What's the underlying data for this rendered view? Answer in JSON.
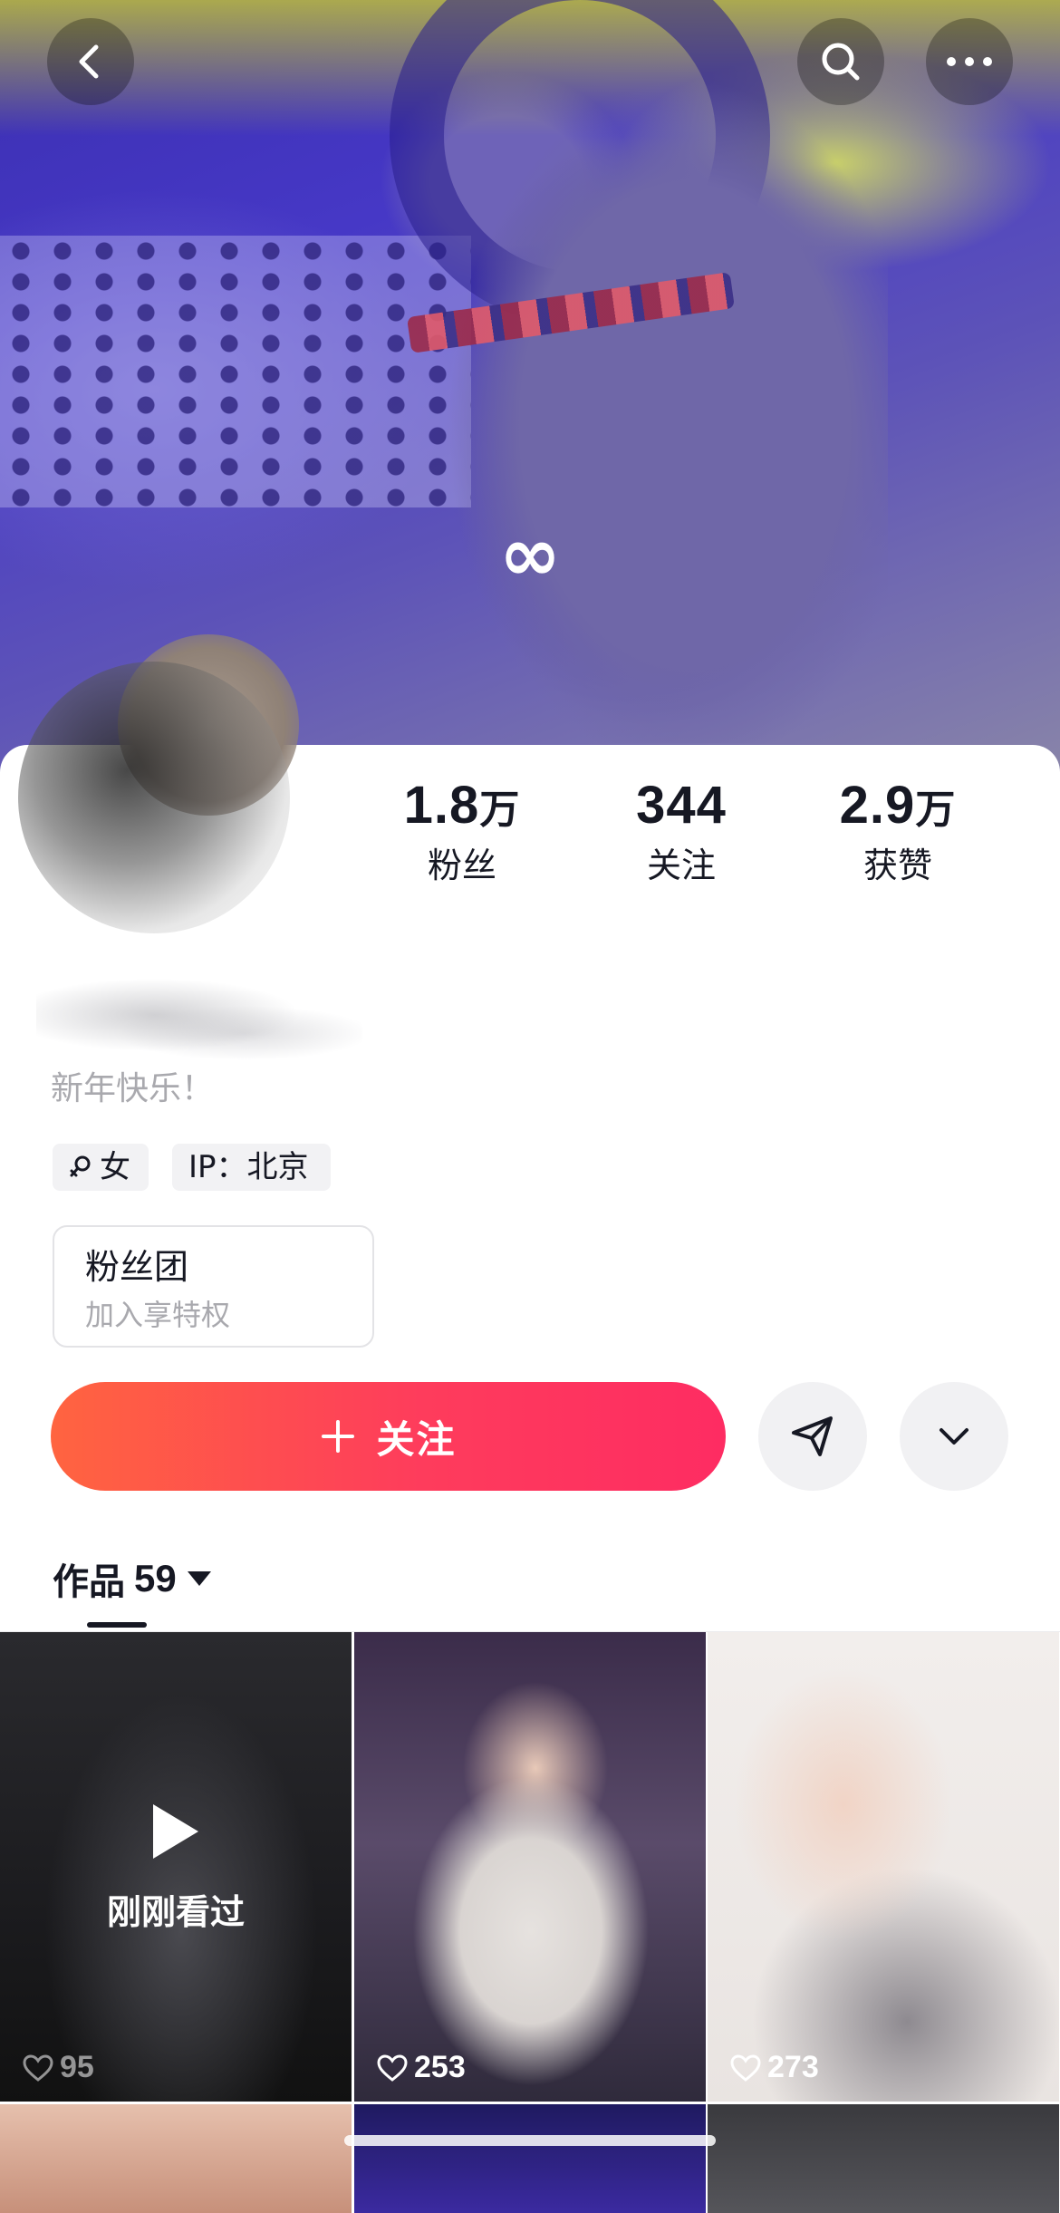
{
  "profile": {
    "bio": "新年快乐！",
    "tags": {
      "gender": "女",
      "ip": "IP：北京"
    }
  },
  "stats": [
    {
      "num": "1.8",
      "unit": "万",
      "label": "粉丝"
    },
    {
      "num": "344",
      "unit": "",
      "label": "关注"
    },
    {
      "num": "2.9",
      "unit": "万",
      "label": "获赞"
    }
  ],
  "fanclub": {
    "title": "粉丝团",
    "subtitle": "加入享特权"
  },
  "actions": {
    "follow_label": "关注"
  },
  "tabs": {
    "works_label": "作品",
    "works_count": "59"
  },
  "grid": {
    "watched_label": "刚刚看过",
    "likes": [
      "95",
      "253",
      "273"
    ]
  },
  "icons": {
    "back": "chevron-left-icon",
    "search": "search-icon",
    "more": "more-icon",
    "cover_badge": "infinity-icon",
    "follow": "plus-icon",
    "share": "paper-plane-icon",
    "expand": "chevron-down-icon",
    "likes": "heart-icon",
    "play": "play-icon"
  },
  "colors": {
    "follow_start": "#ff6440",
    "follow_end": "#fe2c62",
    "text_primary": "#161823",
    "text_secondary": "#a9a9ae"
  }
}
